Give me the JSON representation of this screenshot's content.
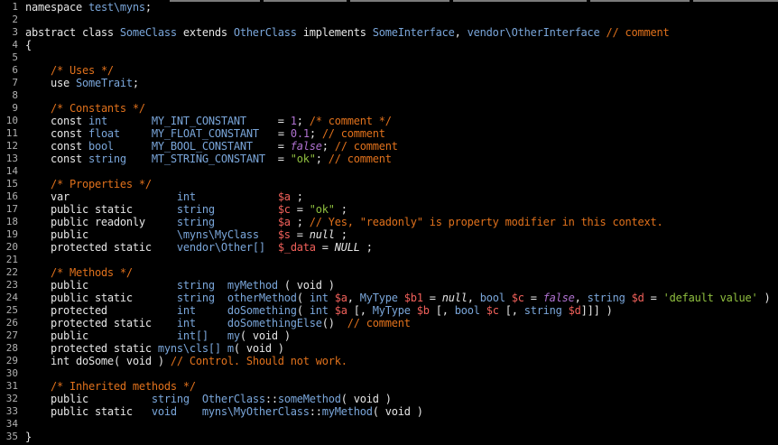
{
  "editor": {
    "lines": [
      {
        "n": "1",
        "tokens": [
          [
            "k",
            "namespace "
          ],
          [
            "t",
            "test\\myns"
          ],
          [
            "p",
            ";"
          ]
        ]
      },
      {
        "n": "2",
        "tokens": []
      },
      {
        "n": "3",
        "tokens": [
          [
            "k",
            "abstract class "
          ],
          [
            "t",
            "SomeClass"
          ],
          [
            "k",
            " extends "
          ],
          [
            "t",
            "OtherClass"
          ],
          [
            "k",
            " implements "
          ],
          [
            "t",
            "SomeInterface"
          ],
          [
            "p",
            ", "
          ],
          [
            "t",
            "vendor\\OtherInterface"
          ],
          [
            "c",
            " // comment"
          ]
        ]
      },
      {
        "n": "4",
        "tokens": [
          [
            "p",
            "{"
          ]
        ]
      },
      {
        "n": "5",
        "tokens": []
      },
      {
        "n": "6",
        "tokens": [
          [
            "p",
            "    "
          ],
          [
            "c",
            "/* Uses */"
          ]
        ]
      },
      {
        "n": "7",
        "tokens": [
          [
            "k",
            "    use "
          ],
          [
            "t",
            "SomeTrait"
          ],
          [
            "p",
            ";"
          ]
        ]
      },
      {
        "n": "8",
        "tokens": []
      },
      {
        "n": "9",
        "tokens": [
          [
            "p",
            "    "
          ],
          [
            "c",
            "/* Constants */"
          ]
        ]
      },
      {
        "n": "10",
        "tokens": [
          [
            "k",
            "    const "
          ],
          [
            "t",
            "int"
          ],
          [
            "p",
            "       "
          ],
          [
            "t",
            "MY_INT_CONSTANT"
          ],
          [
            "p",
            "     = "
          ],
          [
            "n",
            "1"
          ],
          [
            "p",
            "; "
          ],
          [
            "c",
            "/* comment */"
          ]
        ]
      },
      {
        "n": "11",
        "tokens": [
          [
            "k",
            "    const "
          ],
          [
            "t",
            "float"
          ],
          [
            "p",
            "     "
          ],
          [
            "t",
            "MY_FLOAT_CONSTANT"
          ],
          [
            "p",
            "   = "
          ],
          [
            "n",
            "0.1"
          ],
          [
            "p",
            "; "
          ],
          [
            "c",
            "// comment"
          ]
        ]
      },
      {
        "n": "12",
        "tokens": [
          [
            "k",
            "    const "
          ],
          [
            "t",
            "bool"
          ],
          [
            "p",
            "      "
          ],
          [
            "t",
            "MY_BOOL_CONSTANT"
          ],
          [
            "p",
            "    = "
          ],
          [
            "iv",
            "false"
          ],
          [
            "p",
            "; "
          ],
          [
            "c",
            "// comment"
          ]
        ]
      },
      {
        "n": "13",
        "tokens": [
          [
            "k",
            "    const "
          ],
          [
            "t",
            "string"
          ],
          [
            "p",
            "    "
          ],
          [
            "t",
            "MT_STRING_CONSTANT"
          ],
          [
            "p",
            "  = "
          ],
          [
            "s",
            "\"ok\""
          ],
          [
            "p",
            "; "
          ],
          [
            "c",
            "// comment"
          ]
        ]
      },
      {
        "n": "14",
        "tokens": []
      },
      {
        "n": "15",
        "tokens": [
          [
            "p",
            "    "
          ],
          [
            "c",
            "/* Properties */"
          ]
        ]
      },
      {
        "n": "16",
        "tokens": [
          [
            "k",
            "    var"
          ],
          [
            "p",
            "                 "
          ],
          [
            "t",
            "int"
          ],
          [
            "p",
            "             "
          ],
          [
            "v",
            "$a"
          ],
          [
            "p",
            " ;"
          ]
        ]
      },
      {
        "n": "17",
        "tokens": [
          [
            "k",
            "    public static"
          ],
          [
            "p",
            "       "
          ],
          [
            "t",
            "string"
          ],
          [
            "p",
            "          "
          ],
          [
            "v",
            "$c"
          ],
          [
            "p",
            " = "
          ],
          [
            "s",
            "\"ok\""
          ],
          [
            "p",
            " ;"
          ]
        ]
      },
      {
        "n": "18",
        "tokens": [
          [
            "k",
            "    public readonly"
          ],
          [
            "p",
            "     "
          ],
          [
            "t",
            "string"
          ],
          [
            "p",
            "          "
          ],
          [
            "v",
            "$a"
          ],
          [
            "p",
            " ; "
          ],
          [
            "c",
            "// Yes, \"readonly\" is property modifier in this context."
          ]
        ]
      },
      {
        "n": "19",
        "tokens": [
          [
            "k",
            "    public"
          ],
          [
            "p",
            "              "
          ],
          [
            "t",
            "\\myns\\MyClass"
          ],
          [
            "p",
            "   "
          ],
          [
            "v",
            "$s"
          ],
          [
            "p",
            " = "
          ],
          [
            "i",
            "null"
          ],
          [
            "p",
            " ;"
          ]
        ]
      },
      {
        "n": "20",
        "tokens": [
          [
            "k",
            "    protected static"
          ],
          [
            "p",
            "    "
          ],
          [
            "t",
            "vendor\\Other[]"
          ],
          [
            "p",
            "  "
          ],
          [
            "v",
            "$_data"
          ],
          [
            "p",
            " = "
          ],
          [
            "i",
            "NULL"
          ],
          [
            "p",
            " ;"
          ]
        ]
      },
      {
        "n": "21",
        "tokens": []
      },
      {
        "n": "22",
        "tokens": [
          [
            "p",
            "    "
          ],
          [
            "c",
            "/* Methods */"
          ]
        ]
      },
      {
        "n": "23",
        "tokens": [
          [
            "k",
            "    public"
          ],
          [
            "p",
            "              "
          ],
          [
            "t",
            "string"
          ],
          [
            "p",
            "  "
          ],
          [
            "t",
            "myMethod"
          ],
          [
            "p",
            " ( void )"
          ]
        ]
      },
      {
        "n": "24",
        "tokens": [
          [
            "k",
            "    public static"
          ],
          [
            "p",
            "       "
          ],
          [
            "t",
            "string"
          ],
          [
            "p",
            "  "
          ],
          [
            "t",
            "otherMethod"
          ],
          [
            "p",
            "( "
          ],
          [
            "t",
            "int"
          ],
          [
            "p",
            " "
          ],
          [
            "v",
            "$a"
          ],
          [
            "p",
            ", "
          ],
          [
            "t",
            "MyType"
          ],
          [
            "p",
            " "
          ],
          [
            "v",
            "$b1"
          ],
          [
            "p",
            " = "
          ],
          [
            "i",
            "null"
          ],
          [
            "p",
            ", "
          ],
          [
            "t",
            "bool"
          ],
          [
            "p",
            " "
          ],
          [
            "v",
            "$c"
          ],
          [
            "p",
            " = "
          ],
          [
            "iv",
            "false"
          ],
          [
            "p",
            ", "
          ],
          [
            "t",
            "string"
          ],
          [
            "p",
            " "
          ],
          [
            "v",
            "$d"
          ],
          [
            "p",
            " = "
          ],
          [
            "s",
            "'default value'"
          ],
          [
            "p",
            " )"
          ]
        ]
      },
      {
        "n": "25",
        "tokens": [
          [
            "k",
            "    protected"
          ],
          [
            "p",
            "           "
          ],
          [
            "t",
            "int"
          ],
          [
            "p",
            "     "
          ],
          [
            "t",
            "doSomething"
          ],
          [
            "p",
            "( "
          ],
          [
            "t",
            "int"
          ],
          [
            "p",
            " "
          ],
          [
            "v",
            "$a"
          ],
          [
            "p",
            " [, "
          ],
          [
            "t",
            "MyType"
          ],
          [
            "p",
            " "
          ],
          [
            "v",
            "$b"
          ],
          [
            "p",
            " [, "
          ],
          [
            "t",
            "bool"
          ],
          [
            "p",
            " "
          ],
          [
            "v",
            "$c"
          ],
          [
            "p",
            " [, "
          ],
          [
            "t",
            "string"
          ],
          [
            "p",
            " "
          ],
          [
            "v",
            "$d"
          ],
          [
            "p",
            "]]] )"
          ]
        ]
      },
      {
        "n": "26",
        "tokens": [
          [
            "k",
            "    protected static"
          ],
          [
            "p",
            "    "
          ],
          [
            "t",
            "int"
          ],
          [
            "p",
            "     "
          ],
          [
            "t",
            "doSomethingElse"
          ],
          [
            "p",
            "()  "
          ],
          [
            "c",
            "// comment"
          ]
        ]
      },
      {
        "n": "27",
        "tokens": [
          [
            "k",
            "    public"
          ],
          [
            "p",
            "              "
          ],
          [
            "t",
            "int[]"
          ],
          [
            "p",
            "   "
          ],
          [
            "t",
            "my"
          ],
          [
            "p",
            "( void )"
          ]
        ]
      },
      {
        "n": "28",
        "tokens": [
          [
            "k",
            "    protected static "
          ],
          [
            "t",
            "myns\\cls[]"
          ],
          [
            "p",
            " "
          ],
          [
            "t",
            "m"
          ],
          [
            "p",
            "( void )"
          ]
        ]
      },
      {
        "n": "29",
        "tokens": [
          [
            "k",
            "    int doSome"
          ],
          [
            "p",
            "( void ) "
          ],
          [
            "c",
            "// Control. Should not work."
          ]
        ]
      },
      {
        "n": "30",
        "tokens": []
      },
      {
        "n": "31",
        "tokens": [
          [
            "p",
            "    "
          ],
          [
            "c",
            "/* Inherited methods */"
          ]
        ]
      },
      {
        "n": "32",
        "tokens": [
          [
            "k",
            "    public"
          ],
          [
            "p",
            "          "
          ],
          [
            "t",
            "string"
          ],
          [
            "p",
            "  "
          ],
          [
            "t",
            "OtherClass"
          ],
          [
            "p",
            "::"
          ],
          [
            "t",
            "someMethod"
          ],
          [
            "p",
            "( void )"
          ]
        ]
      },
      {
        "n": "33",
        "tokens": [
          [
            "k",
            "    public static"
          ],
          [
            "p",
            "   "
          ],
          [
            "t",
            "void"
          ],
          [
            "p",
            "    "
          ],
          [
            "t",
            "myns\\MyOtherClass"
          ],
          [
            "p",
            "::"
          ],
          [
            "t",
            "myMethod"
          ],
          [
            "p",
            "( void )"
          ]
        ]
      },
      {
        "n": "34",
        "tokens": []
      },
      {
        "n": "35",
        "tokens": [
          [
            "p",
            "}"
          ]
        ]
      }
    ]
  }
}
